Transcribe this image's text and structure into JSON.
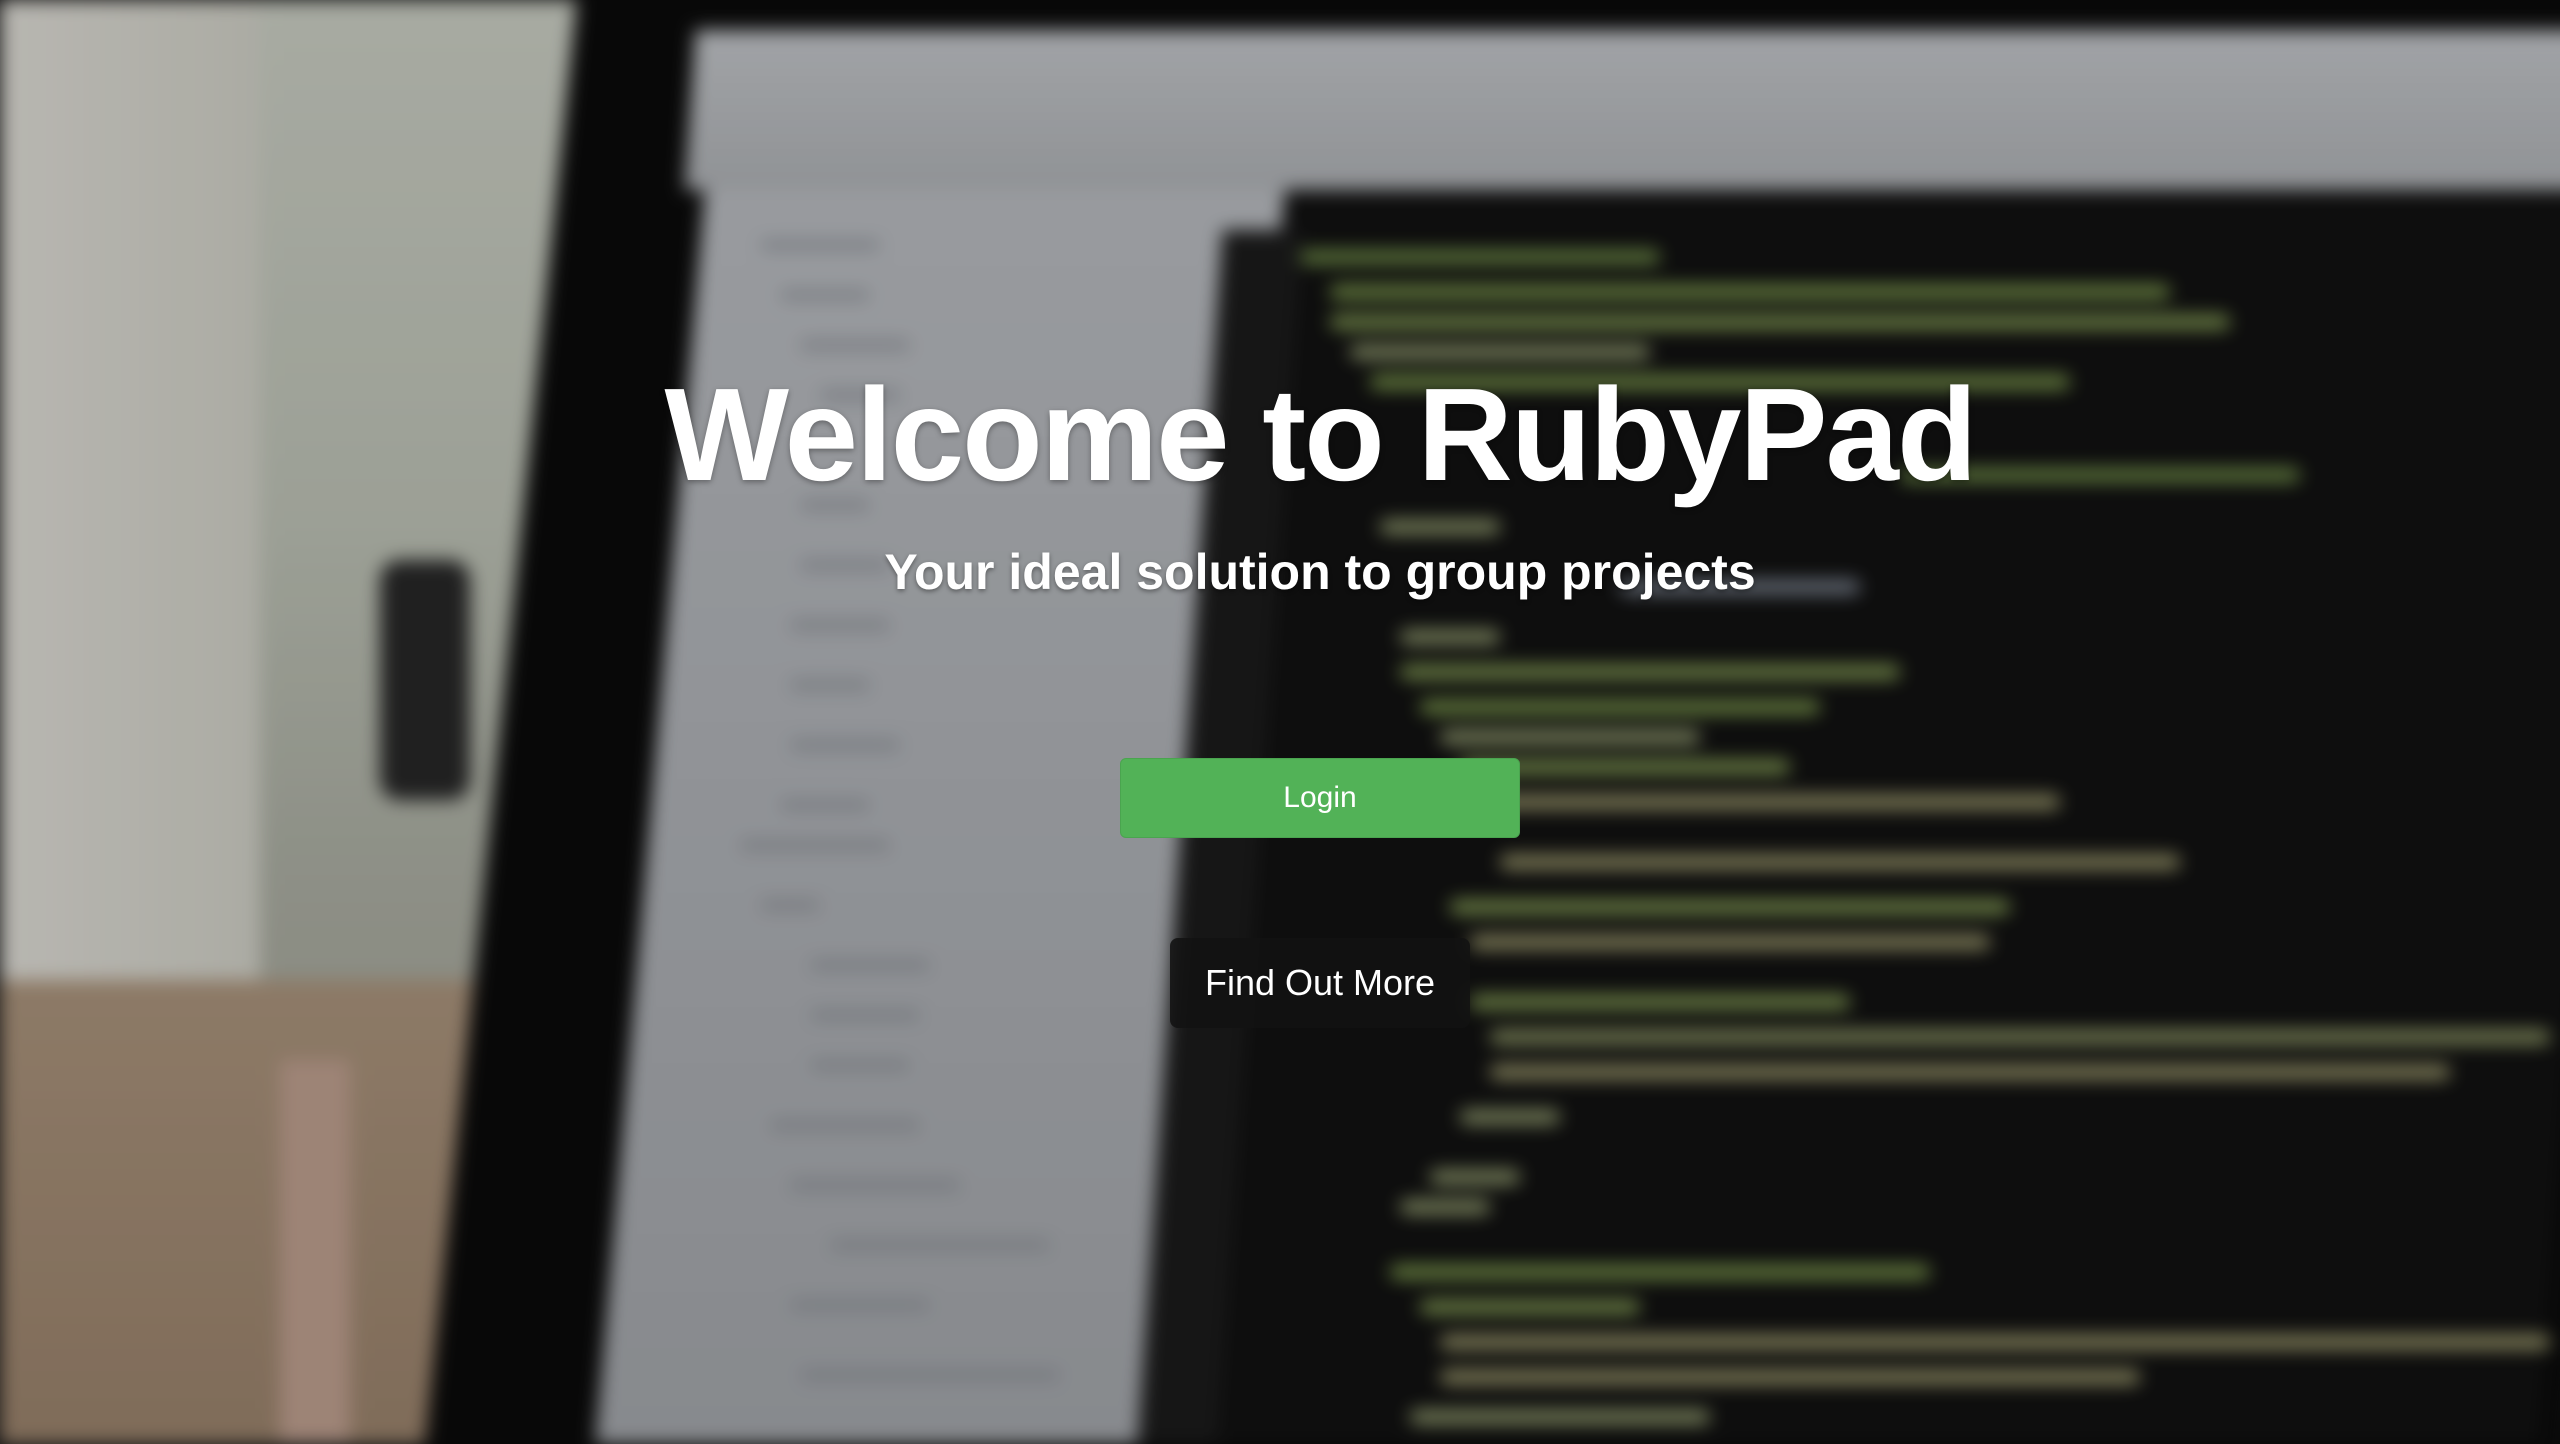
{
  "hero": {
    "title": "Welcome to RubyPad",
    "subtitle": "Your ideal solution to group projects"
  },
  "actions": {
    "login_label": "Login",
    "find_out_more_label": "Find Out More"
  },
  "colors": {
    "login_button": "#52b257",
    "find_out_more_button": "#121212",
    "text": "#ffffff"
  }
}
